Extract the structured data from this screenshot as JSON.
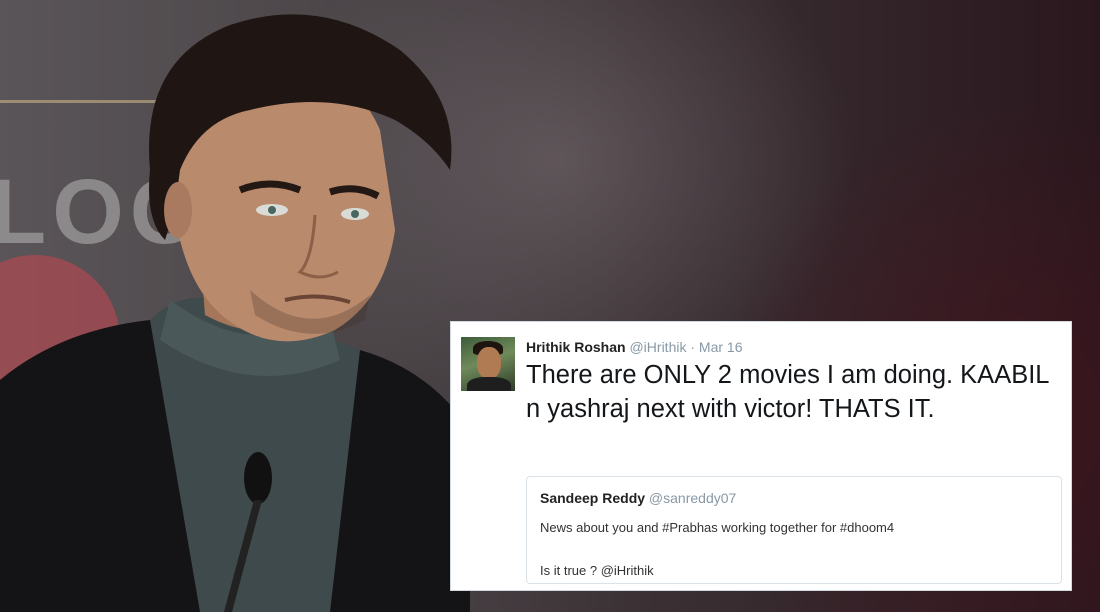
{
  "background": {
    "logo_text": "LOC"
  },
  "tweet": {
    "author_name": "Hrithik Roshan",
    "author_handle": "@iHrithik",
    "separator": "·",
    "date": "Mar 16",
    "text": "There are ONLY 2 movies I am doing. KAABIL n yashraj next with victor! THATS IT."
  },
  "quoted_tweet": {
    "author_name": "Sandeep Reddy",
    "author_handle": "@sanreddy07",
    "line1": "News about you and #Prabhas working together for #dhoom4",
    "line2": "Is it true ? @iHrithik"
  },
  "colors": {
    "card_background": "#ffffff",
    "handle_grey": "#8899a6",
    "text_dark": "#14171a",
    "backdrop_dark": "#2a171d"
  }
}
